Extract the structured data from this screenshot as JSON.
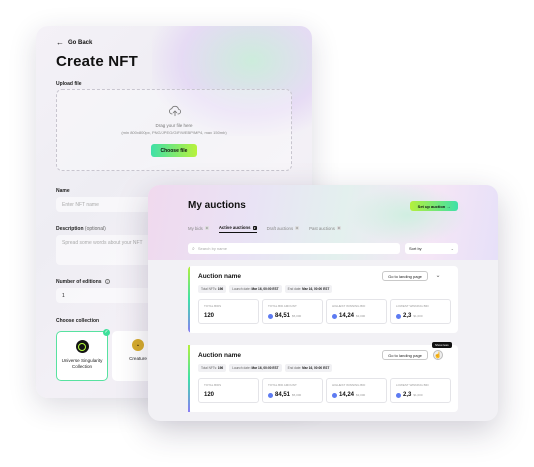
{
  "create": {
    "back_label": "Go Back",
    "title": "Create NFT",
    "upload_label": "Upload file",
    "upload_hint": "Drag your file here",
    "upload_formats": "(min 800x800px, PNG/JPEG/GIF/WEBP/MP4, max 150mb)",
    "choose_file": "Choose file",
    "name_label": "Name",
    "name_placeholder": "Enter NFT name",
    "desc_label": "Description",
    "desc_optional": "(optional)",
    "desc_placeholder": "Spread some words about your NFT",
    "editions_label": "Number of editions",
    "editions_value": "1",
    "collection_label": "Choose collection",
    "collections": [
      {
        "name": "Universe Singularity Collection"
      },
      {
        "name": "Creature"
      }
    ]
  },
  "auctions": {
    "title": "My auctions",
    "setup_btn": "Set up auction →",
    "tabs": [
      {
        "label": "My bids",
        "count": "0"
      },
      {
        "label": "Active auctions",
        "count": "2"
      },
      {
        "label": "Draft auctions",
        "count": "0"
      },
      {
        "label": "Past auctions",
        "count": "0"
      }
    ],
    "search_placeholder": "Search by name",
    "sort_label": "Sort by",
    "items": [
      {
        "name": "Auction name",
        "landing_btn": "Go to landing page",
        "total_label": "Total NFTs:",
        "total_value": "196",
        "launch_label": "Launch date:",
        "launch_value": "Mar 16, 00:00 EST",
        "end_label": "End date:",
        "end_value": "Mar 16, 00:00 EST",
        "stats": [
          {
            "label": "TOTAL BIDS",
            "value": "120",
            "usd": ""
          },
          {
            "label": "TOTAL BID AMOUNT",
            "value": "84,51",
            "usd": "$5,000"
          },
          {
            "label": "HIGHEST WINNING BID",
            "value": "14,24",
            "usd": "$3,000"
          },
          {
            "label": "LOWEST WINNING BID",
            "value": "2,3",
            "usd": "$1,000"
          }
        ]
      },
      {
        "name": "Auction name",
        "landing_btn": "Go to landing page",
        "tooltip": "Show less",
        "total_label": "Total NFTs:",
        "total_value": "196",
        "launch_label": "Launch date:",
        "launch_value": "Mar 16, 00:00 EST",
        "end_label": "End date:",
        "end_value": "Mar 16, 00:00 EST",
        "stats": [
          {
            "label": "TOTAL BIDS",
            "value": "120",
            "usd": ""
          },
          {
            "label": "TOTAL BID AMOUNT",
            "value": "84,51",
            "usd": "$5,000"
          },
          {
            "label": "HIGHEST WINNING BID",
            "value": "14,24",
            "usd": "$3,000"
          },
          {
            "label": "LOWEST WINNING BID",
            "value": "2,3",
            "usd": "$1,000"
          }
        ]
      }
    ]
  },
  "colors": {
    "accent_green": "#3fe0a8",
    "accent_lime": "#b4f03c",
    "eth_blue": "#5d7bf2"
  }
}
